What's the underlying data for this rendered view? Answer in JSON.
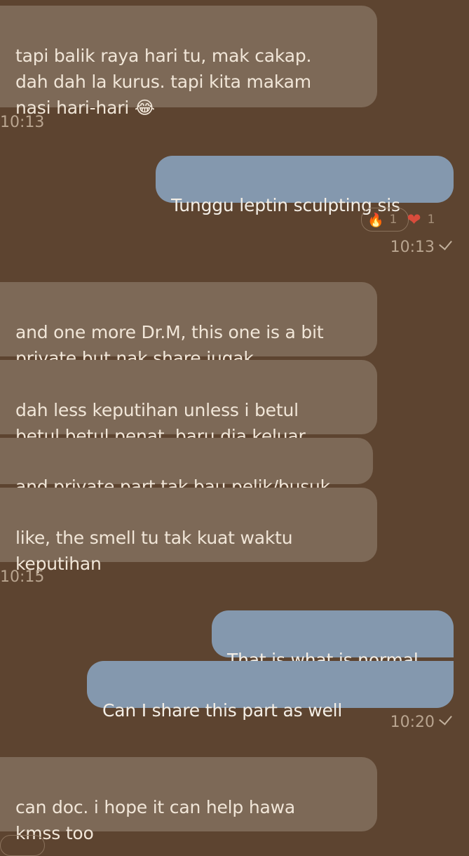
{
  "chat": {
    "messages": [
      {
        "direction": "in",
        "text": "tapi balik raya hari tu, mak cakap.\ndah dah la kurus. tapi kita makam\nnasi hari-hari 😂"
      },
      {
        "direction": "out",
        "text": "Tunggu leptin sculpting sis"
      },
      {
        "direction": "in",
        "text": "and one more Dr.M, this one is a bit\nprivate but nak share jugak"
      },
      {
        "direction": "in",
        "text": "dah less keputihan unless i betul\nbetul betul penat, baru dia keluar"
      },
      {
        "direction": "in",
        "text": "and private part tak bau pelik/busuk"
      },
      {
        "direction": "in",
        "text": "like, the smell tu tak kuat waktu\nkeputihan"
      },
      {
        "direction": "out",
        "text": "That is what is normal"
      },
      {
        "direction": "out",
        "text": "Can I share this part as well"
      },
      {
        "direction": "in",
        "text": "can doc. i hope it can help hawa\nkmss too"
      }
    ],
    "timestamps": [
      "10:13",
      "10:13",
      "10:15",
      "10:20"
    ],
    "reactions": [
      {
        "emoji": "🔥",
        "count": "1",
        "icon": "fire-icon"
      },
      {
        "emoji": "❤",
        "count": "1",
        "icon": "heart-icon"
      }
    ]
  },
  "colors": {
    "background": "#5d4430",
    "incoming_bubble": "#7d6957",
    "outgoing_bubble": "#8498ae",
    "timestamp": "#b9a590"
  }
}
